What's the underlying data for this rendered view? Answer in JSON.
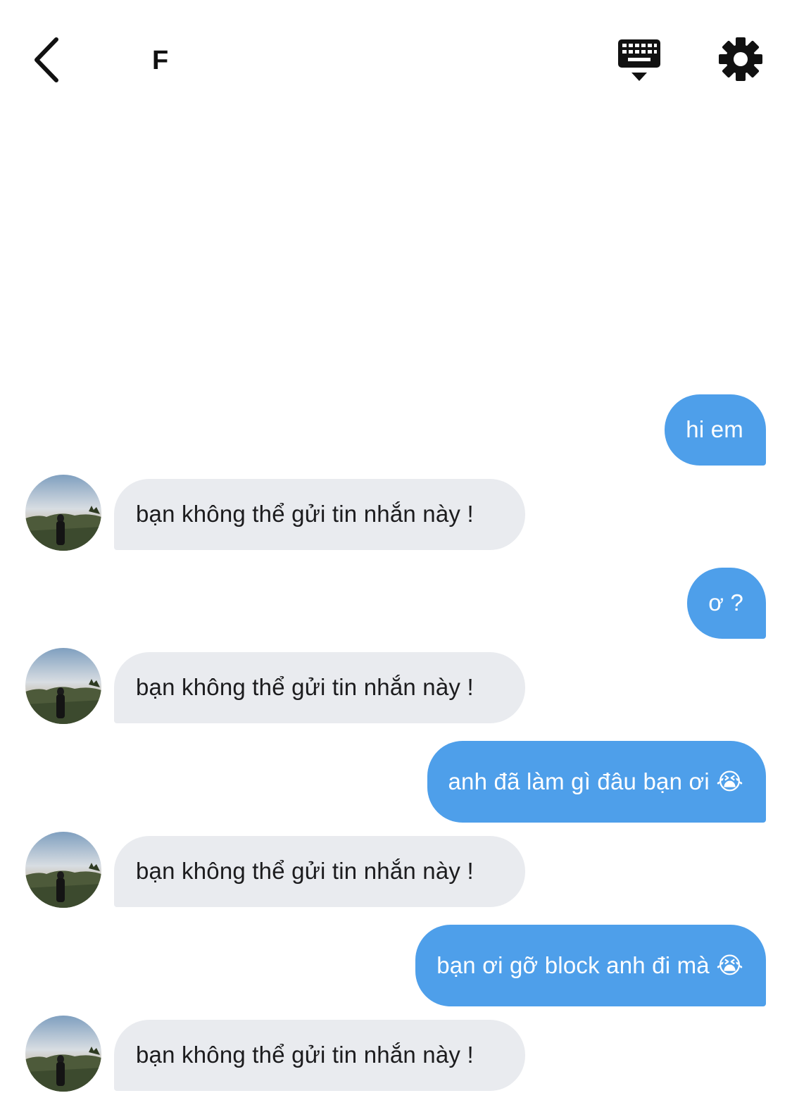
{
  "header": {
    "title": "F",
    "icons": {
      "back": "chevron-left-icon",
      "keyboard": "keyboard-hide-icon",
      "settings": "gear-icon"
    }
  },
  "colors": {
    "outgoing_bubble": "#4e9fea",
    "incoming_bubble": "#e9ebef",
    "outgoing_text": "#ffffff",
    "incoming_text": "#1c1c1e"
  },
  "messages": [
    {
      "direction": "out",
      "text": "hi em"
    },
    {
      "direction": "in",
      "text": "bạn không thể gửi tin nhắn này !"
    },
    {
      "direction": "out",
      "text": "ơ ?"
    },
    {
      "direction": "in",
      "text": "bạn không thể gửi tin nhắn này !"
    },
    {
      "direction": "out",
      "text": "anh đã làm gì đâu bạn ơi 😭"
    },
    {
      "direction": "in",
      "text": "bạn không thể gửi tin nhắn này !"
    },
    {
      "direction": "out",
      "text": "bạn ơi gỡ block anh đi mà 😭"
    },
    {
      "direction": "in",
      "text": "bạn không thể gửi tin nhắn này !"
    }
  ]
}
